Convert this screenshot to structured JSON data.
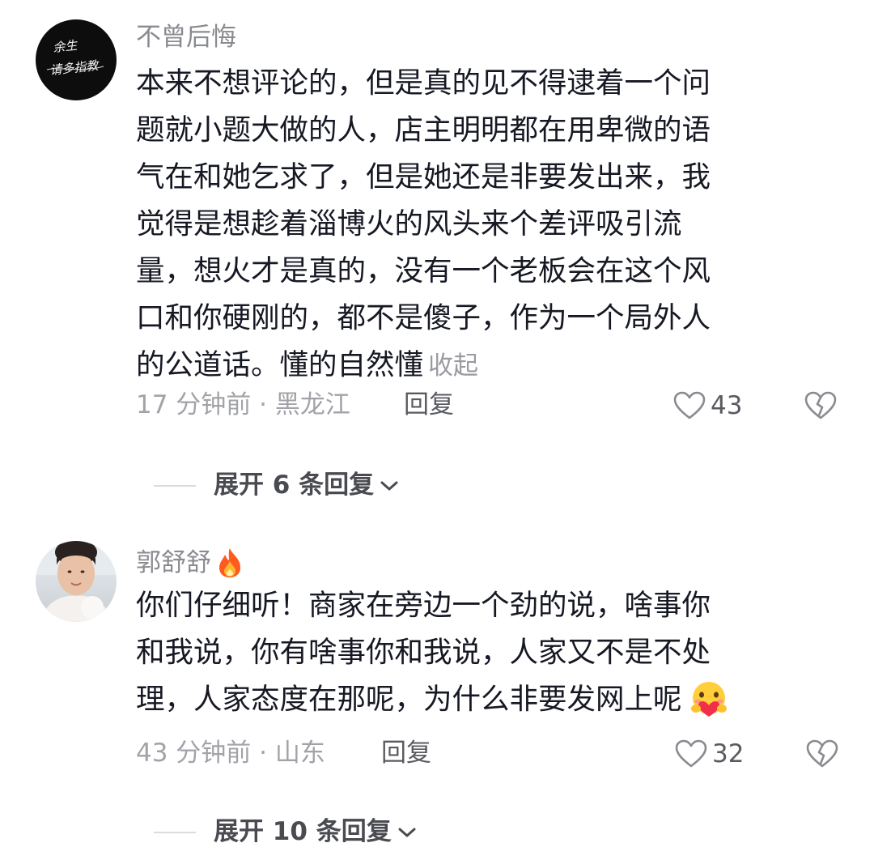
{
  "comments": [
    {
      "username": "不曾后悔",
      "avatar_text": "余生请多指教",
      "text_lines": [
        "本来不想评论的，但是真的见不得逮着一个问",
        "题就小题大做的人，店主明明都在用卑微的语",
        "气在和她乞求了，但是她还是非要发出来，我",
        "觉得是想趁着淄博火的风头来个差评吸引流",
        "量，想火才是真的，没有一个老板会在这个风",
        "口和你硬刚的，都不是傻子，作为一个局外人",
        "的公道话。懂的自然懂"
      ],
      "collapse_label": "收起",
      "meta": "17 分钟前 · 黑龙江",
      "reply_label": "回复",
      "like_count": "43",
      "expand_label": "展开 6 条回复"
    },
    {
      "username": "郭舒舒",
      "text_lines": [
        "你们仔细听！商家在旁边一个劲的说，啥事你",
        "和我说，你有啥事你和我说，人家又不是不处",
        "理，人家态度在那呢，为什么非要发网上呢"
      ],
      "meta": "43 分钟前 · 山东",
      "reply_label": "回复",
      "like_count": "32",
      "expand_label": "展开 10 条回复"
    }
  ],
  "icons": {
    "like": "heart-outline-icon",
    "dislike": "broken-heart-icon",
    "expand": "chevron-down-icon",
    "badge": "fire-icon",
    "emoji": "heart-hug-emoji-icon"
  },
  "colors": {
    "text_primary": "#161823",
    "text_secondary": "#8a8b91",
    "icon_gray": "#8a8b91"
  }
}
